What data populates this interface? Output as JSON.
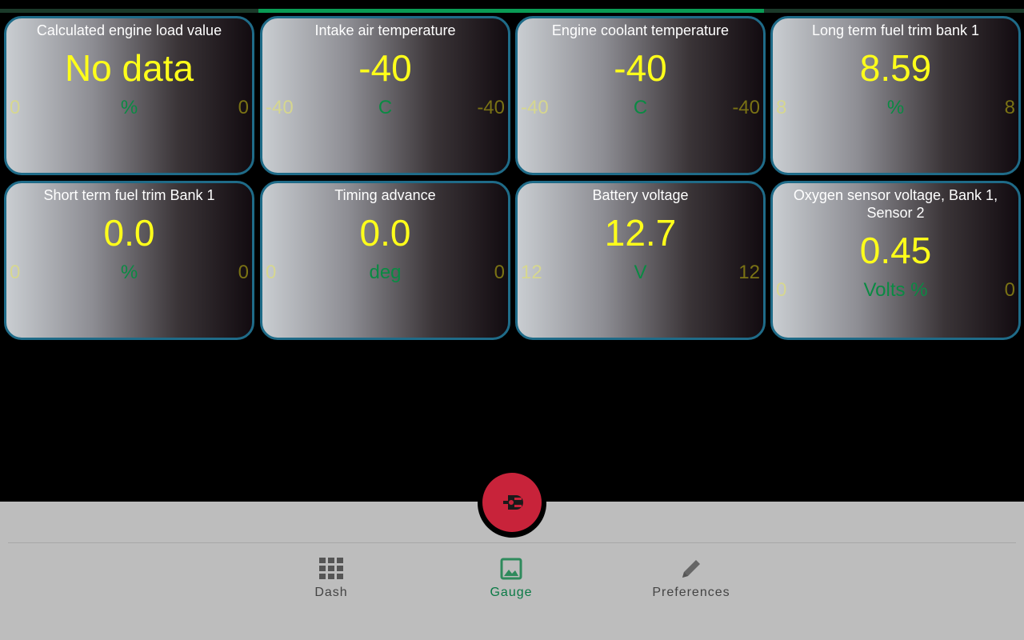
{
  "progress": {
    "fraction": 0.49
  },
  "gauges": [
    {
      "title": "Calculated engine load value",
      "value": "No data",
      "min": "0",
      "unit": "%",
      "max": "0"
    },
    {
      "title": "Intake air temperature",
      "value": "-40",
      "min": "-40",
      "unit": "C",
      "max": "-40"
    },
    {
      "title": "Engine coolant temperature",
      "value": "-40",
      "min": "-40",
      "unit": "C",
      "max": "-40"
    },
    {
      "title": "Long term fuel trim bank 1",
      "value": "8.59",
      "min": "8",
      "unit": "%",
      "max": "8"
    },
    {
      "title": "Short term fuel trim Bank 1",
      "value": "0.0",
      "min": "0",
      "unit": "%",
      "max": "0"
    },
    {
      "title": "Timing advance",
      "value": "0.0",
      "min": "0",
      "unit": "deg",
      "max": "0"
    },
    {
      "title": "Battery voltage",
      "value": "12.7",
      "min": "12",
      "unit": "V",
      "max": "12"
    },
    {
      "title": "Oxygen sensor voltage, Bank 1, Sensor 2",
      "value": "0.45",
      "min": "0",
      "unit": "Volts %",
      "max": "0"
    }
  ],
  "fab": {
    "icon": "plug-icon",
    "color": "#c8233a"
  },
  "nav": {
    "items": [
      {
        "label": "Dash",
        "icon": "grid-icon"
      },
      {
        "label": "Gauge",
        "icon": "image-icon",
        "active": true
      },
      {
        "label": "Preferences",
        "icon": "pencil-icon"
      }
    ]
  },
  "colors": {
    "value": "#ffff1a",
    "unit": "#0a8a43",
    "card_border": "#1f6b88",
    "active_nav": "#0a7a45",
    "progress": "#0a9b55"
  }
}
